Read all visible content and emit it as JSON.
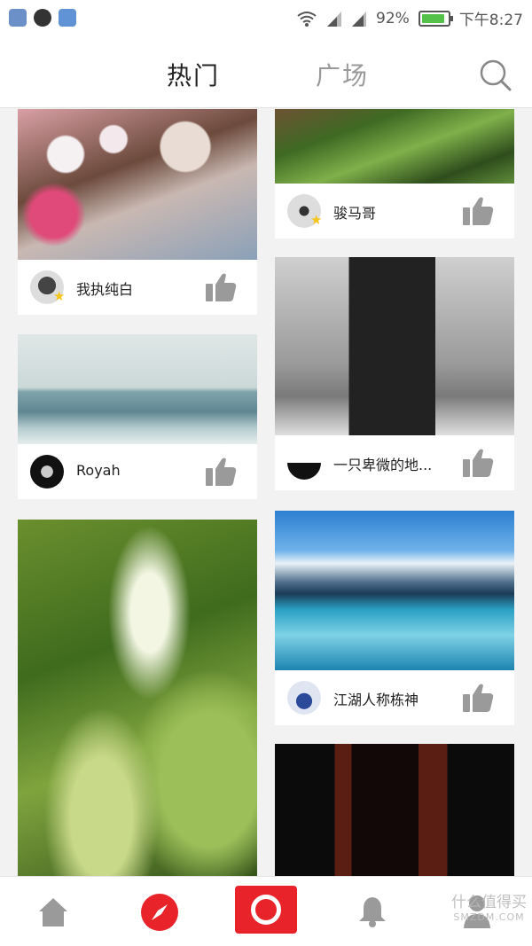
{
  "status_bar": {
    "battery": "92%",
    "time": "下午8:27",
    "battery_level": 0.92
  },
  "header": {
    "tabs": [
      "热门",
      "广场"
    ],
    "active_tab": "热门"
  },
  "feed": {
    "cards": [
      {
        "username": "我执纯白",
        "photo": "cherry blossoms"
      },
      {
        "username": "骏马哥",
        "photo": "trees from below"
      },
      {
        "username": "Royah",
        "photo": "sea with seagull"
      },
      {
        "username": "一只卑微的地...",
        "photo": "old black door"
      },
      {
        "username": "江湖人称栋神",
        "photo": "mountain lake reflection"
      },
      {
        "username": "",
        "photo": "dandelion seed"
      },
      {
        "username": "",
        "photo": "dark red doorway"
      }
    ]
  },
  "bottom_nav": {
    "items": [
      "home",
      "discover",
      "camera",
      "notifications",
      "profile"
    ]
  },
  "watermark": {
    "name": "什么值得买",
    "url": "SMZDM.COM"
  },
  "colors": {
    "accent": "#e8232a",
    "icon_gray": "#9a9a9a",
    "battery_green": "#54c24a"
  }
}
